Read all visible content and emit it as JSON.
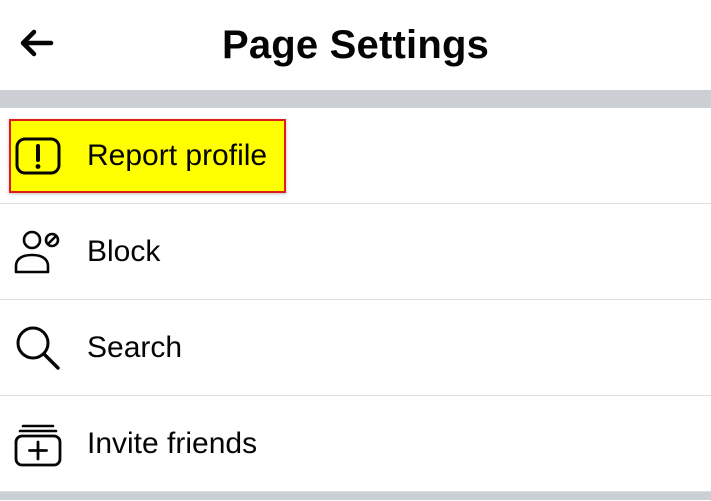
{
  "header": {
    "title": "Page Settings",
    "back_icon": "arrow-left-icon"
  },
  "menu": {
    "items": [
      {
        "label": "Report profile",
        "icon": "exclamation-box-icon",
        "highlighted": true
      },
      {
        "label": "Block",
        "icon": "person-block-icon",
        "highlighted": false
      },
      {
        "label": "Search",
        "icon": "search-icon",
        "highlighted": false
      },
      {
        "label": "Invite friends",
        "icon": "invite-add-icon",
        "highlighted": false
      }
    ]
  },
  "colors": {
    "highlight_fill": "#ffff00",
    "highlight_border": "#e01b1b",
    "separator": "#ccd0d5",
    "text": "#050505"
  }
}
